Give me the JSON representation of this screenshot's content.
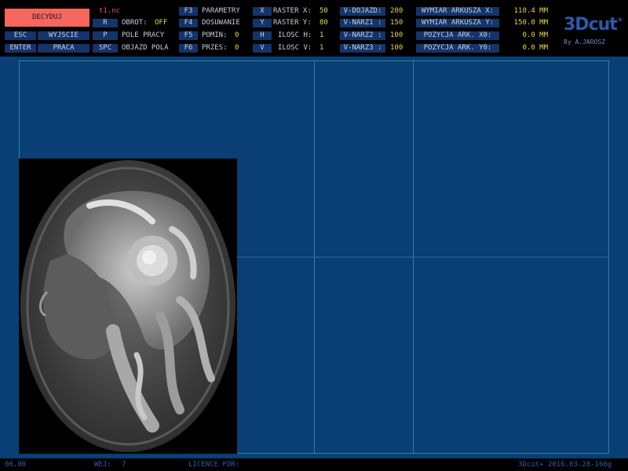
{
  "header": {
    "decide_button": "DECYDUJ",
    "filename": "t1.nc",
    "logo": "3Dcut",
    "logo_mark": "+",
    "byline": "By A.JAROSZ"
  },
  "left_keys": [
    {
      "key": "ESC",
      "label": "WYJSCIE"
    },
    {
      "key": "ENTER",
      "label": "PRACA"
    }
  ],
  "commands": {
    "rotate": {
      "key": "R",
      "label": "OBROT:",
      "value": "OFF"
    },
    "work_area": {
      "key": "P",
      "label": "POLE PRACY"
    },
    "bypass": {
      "key": "SPC",
      "label": "OBJAZD POLA"
    },
    "parameters": {
      "key": "F3",
      "label": "PARAMETRY"
    },
    "feed": {
      "key": "F4",
      "label": "DOSUWANIE"
    },
    "skip": {
      "key": "F5",
      "label": "POMIN:",
      "value": "0"
    },
    "shift": {
      "key": "F6",
      "label": "PRZES:",
      "value": "0"
    },
    "raster_x": {
      "key": "X",
      "label": "RASTER X:",
      "value": "50"
    },
    "raster_y": {
      "key": "Y",
      "label": "RASTER Y:",
      "value": "80"
    },
    "count_h": {
      "key": "H",
      "label": "ILOSC H:",
      "value": "1"
    },
    "count_v": {
      "key": "V",
      "label": "ILOSC V:",
      "value": "1"
    }
  },
  "speeds": [
    {
      "label": "V-DOJAZD:",
      "value": "200"
    },
    {
      "label": "V-NARZ1 :",
      "value": "150"
    },
    {
      "label": "V-NARZ2 :",
      "value": "100"
    },
    {
      "label": "V-NARZ3 :",
      "value": "100"
    }
  ],
  "sheet_params": [
    {
      "label": "WYMIAR ARKUSZA X:",
      "value": "110.4 MM"
    },
    {
      "label": "WYMIAR ARKUSZA Y:",
      "value": "150.0 MM"
    },
    {
      "label": "POZYCJA ARK. X0:",
      "value": "0.0 MM"
    },
    {
      "label": "POZYCJA ARK. Y0:",
      "value": "0.0 MM"
    }
  ],
  "status": {
    "coord": "00.00",
    "layer_label": "WEJ:",
    "layer_value": "7",
    "licence": "LICENCE FOR:",
    "version": "3Dcut+ 2016.03.28-166g"
  },
  "colors": {
    "workspace": "#093f75",
    "key_bg": "#14346a",
    "value": "#e8d84a",
    "decide_button": "#f5665c",
    "grid_line": "#2d8496"
  }
}
